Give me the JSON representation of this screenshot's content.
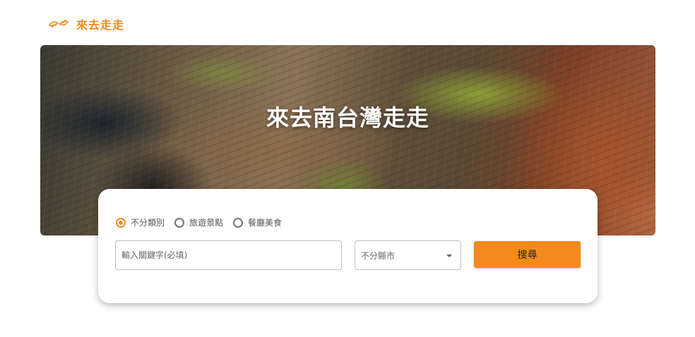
{
  "header": {
    "site_name": "來去走走",
    "logo_icon": "hands-logo-icon",
    "brand_color": "#f28b19"
  },
  "hero": {
    "title": "來去南台灣走走"
  },
  "search": {
    "category_options": [
      {
        "label": "不分類別",
        "selected": true
      },
      {
        "label": "旅遊景點",
        "selected": false
      },
      {
        "label": "餐廳美食",
        "selected": false
      }
    ],
    "keyword_placeholder": "輸入關鍵字(必填)",
    "keyword_value": "",
    "city_select_value": "不分縣市",
    "search_button_label": "搜尋",
    "accent_color": "#f28b19"
  }
}
